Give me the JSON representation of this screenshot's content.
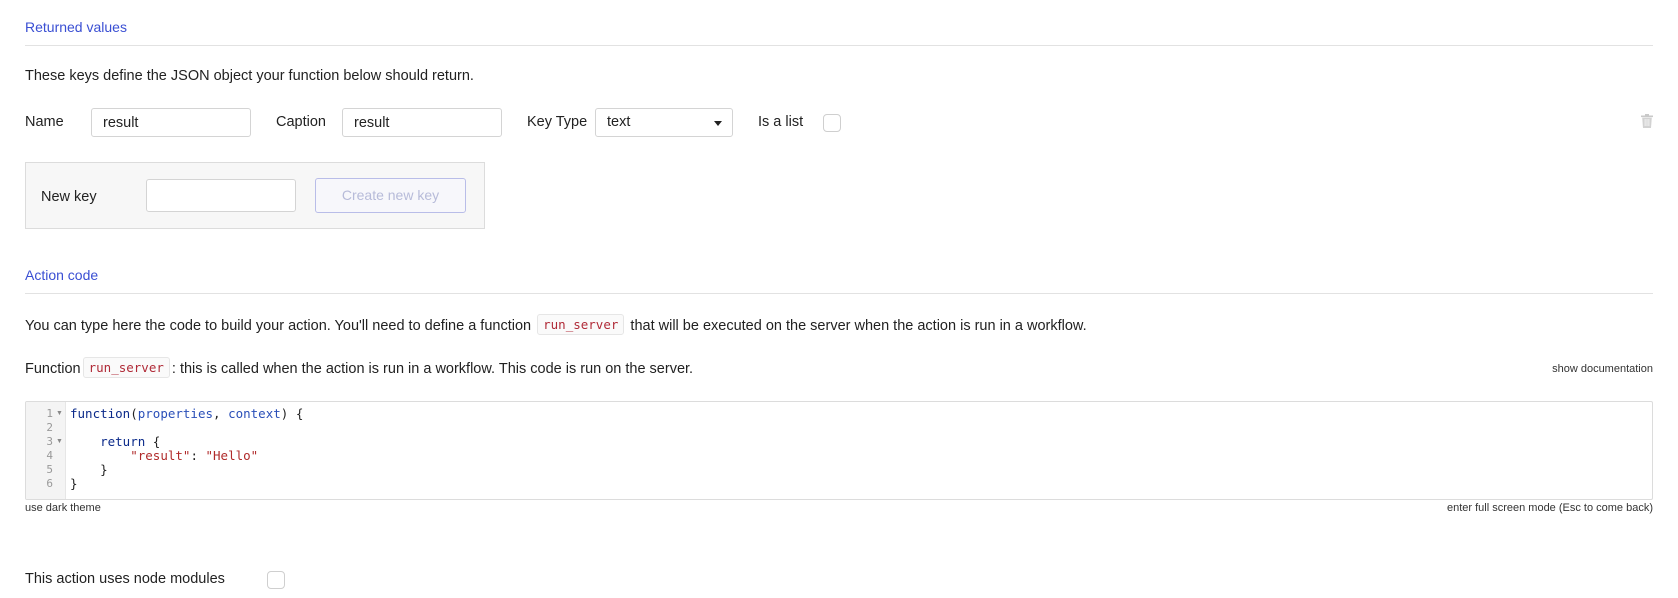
{
  "returned_values": {
    "title": "Returned values",
    "description": "These keys define the JSON object your function below should return.",
    "name_label": "Name",
    "name_value": "result",
    "caption_label": "Caption",
    "caption_value": "result",
    "key_type_label": "Key Type",
    "key_type_value": "text",
    "is_list_label": "Is a list",
    "is_list_checked": false,
    "delete_icon": "trash-icon"
  },
  "new_key": {
    "label": "New key",
    "value": "",
    "button_label": "Create new key"
  },
  "action_code": {
    "title": "Action code",
    "description_before": "You can type here the code to build your action. You'll need to define a function",
    "description_code": "run_server",
    "description_after": "that will be executed on the server when the action is run in a workflow.",
    "function_label": "Function",
    "function_code": "run_server",
    "function_after": ": this is called when the action is run in a workflow. This code is run on the server.",
    "show_docs": "show documentation",
    "editor": {
      "line_numbers": [
        "1",
        "2",
        "3",
        "4",
        "5",
        "6"
      ],
      "lines": [
        "function(properties, context) {",
        "",
        "    return {",
        "        \"result\": \"Hello\"",
        "    }",
        "}"
      ]
    },
    "dark_theme_link": "use dark theme",
    "fullscreen_link": "enter full screen mode (Esc to come back)"
  },
  "node_modules": {
    "label": "This action uses node modules",
    "checked": false
  },
  "colors": {
    "section_title": "#3a4fd3",
    "inline_code": "#b02a37",
    "code_keyword": "#0b2a8a",
    "code_string": "#b02a2a"
  }
}
